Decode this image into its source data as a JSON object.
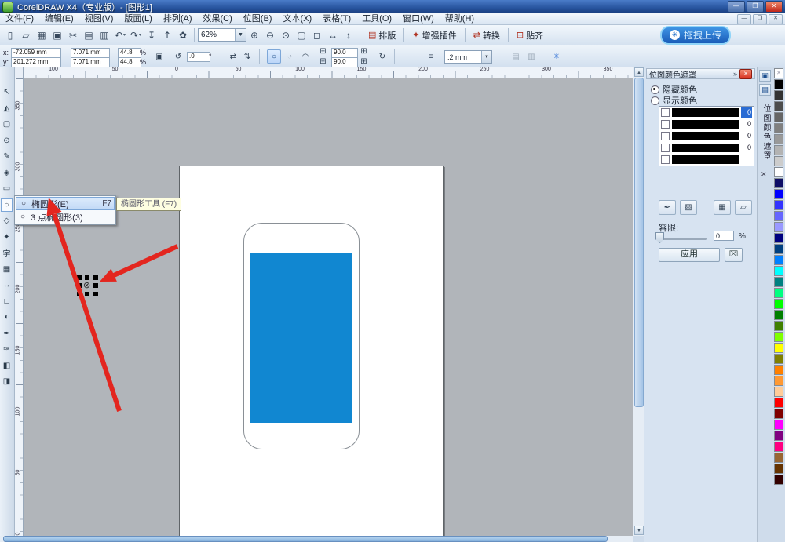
{
  "colors": {
    "accent_blue": "#2a6cd4",
    "annotation_red": "#e3261f",
    "screen_blue": "#1187d1",
    "workspace_gray": "#b1b5ba"
  },
  "window": {
    "title": "CorelDRAW X4（专业版）- [图形1]",
    "controls": {
      "minimize": "—",
      "maximize": "❐",
      "close": "✕"
    }
  },
  "menu_bar": {
    "items": [
      "文件(F)",
      "编辑(E)",
      "视图(V)",
      "版面(L)",
      "排列(A)",
      "效果(C)",
      "位图(B)",
      "文本(X)",
      "表格(T)",
      "工具(O)",
      "窗口(W)",
      "帮助(H)"
    ],
    "doc_controls": [
      "—",
      "❐",
      "✕"
    ]
  },
  "standard_toolbar": {
    "icon_buttons": [
      {
        "name": "new-document-button",
        "glyph": "▯"
      },
      {
        "name": "open-button",
        "glyph": "▱"
      },
      {
        "name": "save-button",
        "glyph": "▦"
      },
      {
        "name": "print-button",
        "glyph": "▣"
      },
      {
        "name": "cut-button",
        "glyph": "✂"
      },
      {
        "name": "copy-button",
        "glyph": "▤"
      },
      {
        "name": "paste-button",
        "glyph": "▥"
      },
      {
        "name": "undo-button",
        "glyph": "↶",
        "dropdown": true
      },
      {
        "name": "redo-button",
        "glyph": "↷",
        "dropdown": true
      },
      {
        "name": "import-button",
        "glyph": "↧"
      },
      {
        "name": "export-button",
        "glyph": "↥"
      },
      {
        "name": "app-launcher-button",
        "glyph": "✿"
      }
    ],
    "zoom_combo": "62%",
    "zoom_tools": [
      {
        "name": "zoom-in-button",
        "glyph": "⊕"
      },
      {
        "name": "zoom-out-button",
        "glyph": "⊖"
      },
      {
        "name": "zoom-selected-button",
        "glyph": "⊙"
      },
      {
        "name": "zoom-all-objects-button",
        "glyph": "▢"
      },
      {
        "name": "zoom-page-button",
        "glyph": "◻"
      },
      {
        "name": "zoom-width-button",
        "glyph": "↔"
      },
      {
        "name": "zoom-height-button",
        "glyph": "↕"
      }
    ],
    "text_buttons": [
      {
        "name": "layout-button",
        "glyph": "▤",
        "label": "排版"
      },
      {
        "name": "plugin-button",
        "glyph": "✦",
        "label": "增强插件"
      },
      {
        "name": "convert-button",
        "glyph": "⇄",
        "label": "转换"
      },
      {
        "name": "snap-button",
        "glyph": "⊞",
        "label": "贴齐"
      }
    ],
    "upload_button": {
      "label": "拖拽上传",
      "badge_glyph": "✳"
    }
  },
  "property_bar": {
    "x_label": "x:",
    "x_value": "-72.059 mm",
    "y_label": "y:",
    "y_value": "201.272 mm",
    "width_value": "7.071 mm",
    "height_value": "7.071 mm",
    "scale_x": "44.8",
    "scale_y": "44.8",
    "scale_unit": "%",
    "lock_glyph": "▣",
    "rotation_glyph": "↺",
    "rotation_value": ".0",
    "rotation_unit": "°",
    "mirror_h_glyph": "⇄",
    "mirror_v_glyph": "⇅",
    "ellipse_glyph": "○",
    "pie_glyph": "◔",
    "arc_glyph": "◠",
    "grid_glyph": "⊞",
    "arc_start": "90.0",
    "arc_end": "90.0",
    "direction_glyph": "↻",
    "wrap_glyph": "≡",
    "outline_width": ".2 mm",
    "extra1_glyph": "▤",
    "extra2_glyph": "▥",
    "gear_glyph": "✳"
  },
  "rulers": {
    "unit": "mm",
    "top_labels": [
      "100",
      "50",
      "0",
      "50",
      "100",
      "150",
      "200",
      "250",
      "300",
      "350"
    ],
    "left_labels": [
      "350",
      "300",
      "250",
      "200",
      "150",
      "100",
      "50",
      "0"
    ]
  },
  "toolbox": {
    "tools": [
      {
        "name": "pick-tool",
        "glyph": "↖"
      },
      {
        "name": "shape-tool",
        "glyph": "◭"
      },
      {
        "name": "crop-tool",
        "glyph": "▢"
      },
      {
        "name": "zoom-tool",
        "glyph": "⊙"
      },
      {
        "name": "freehand-tool",
        "glyph": "✎"
      },
      {
        "name": "smart-fill-tool",
        "glyph": "◈"
      },
      {
        "name": "rectangle-tool",
        "glyph": "▭"
      },
      {
        "name": "ellipse-tool",
        "glyph": "○",
        "active": true
      },
      {
        "name": "polygon-tool",
        "glyph": "◇"
      },
      {
        "name": "basic-shapes-tool",
        "glyph": "✦"
      },
      {
        "name": "text-tool",
        "glyph": "字"
      },
      {
        "name": "table-tool",
        "glyph": "▦"
      },
      {
        "name": "dimension-tool",
        "glyph": "↔"
      },
      {
        "name": "connector-tool",
        "glyph": "∟"
      },
      {
        "name": "blend-tool",
        "glyph": "◐"
      },
      {
        "name": "eyedropper-tool",
        "glyph": "✒"
      },
      {
        "name": "outline-pen-tool",
        "glyph": "✑"
      },
      {
        "name": "fill-tool",
        "glyph": "◧"
      },
      {
        "name": "interactive-fill-tool",
        "glyph": "◨"
      }
    ]
  },
  "flyout": {
    "items": [
      {
        "icon": "○",
        "label": "椭圆形(E)",
        "shortcut": "F7",
        "selected": true
      },
      {
        "icon": "○",
        "label": "3 点椭圆形(3)",
        "shortcut": "",
        "selected": false
      }
    ],
    "tooltip": "椭圆形工具 (F7)"
  },
  "docker": {
    "title": "位图颜色遮罩",
    "collapse_glyph": "»",
    "close_glyph": "✕",
    "radio_hide": "隐藏颜色",
    "radio_show": "显示颜色",
    "radio_selected": "hide",
    "mask_rows": [
      {
        "checked": false,
        "value": "0",
        "selected": true
      },
      {
        "checked": false,
        "value": "0",
        "selected": false
      },
      {
        "checked": false,
        "value": "0",
        "selected": false
      },
      {
        "checked": false,
        "value": "0",
        "selected": false
      },
      {
        "checked": false,
        "value": "",
        "selected": false
      }
    ],
    "buttons": [
      {
        "name": "eyedropper-button",
        "glyph": "✒"
      },
      {
        "name": "add-color-button",
        "glyph": "▨"
      },
      {
        "name": "save-mask-button",
        "glyph": "▦"
      },
      {
        "name": "open-mask-button",
        "glyph": "▱"
      }
    ],
    "tolerance_label": "容限:",
    "tolerance_value": "0",
    "tolerance_unit": "%",
    "apply_label": "应用",
    "delete_glyph": "⌧",
    "tab_title": "位图颜色遮罩",
    "tab_icons": [
      {
        "name": "docker-tab-hint-icon",
        "glyph": "▣"
      },
      {
        "name": "docker-tab-mask-icon",
        "glyph": "▤"
      }
    ],
    "tab_close_glyph": "✕"
  },
  "palette": {
    "colors": [
      "none",
      "#000000",
      "#333333",
      "#4d4d4d",
      "#666666",
      "#808080",
      "#999999",
      "#b3b3b3",
      "#cccccc",
      "#ffffff",
      "#0d0d66",
      "#0000ff",
      "#3333ff",
      "#6666ff",
      "#9999ff",
      "#000080",
      "#004080",
      "#0080ff",
      "#00ffff",
      "#008080",
      "#00ff80",
      "#00ff00",
      "#008000",
      "#408000",
      "#80ff00",
      "#ffff00",
      "#808000",
      "#ff8000",
      "#ff9933",
      "#ffcc99",
      "#ff0000",
      "#800000",
      "#ff00ff",
      "#800080",
      "#ff0080",
      "#996633",
      "#663300",
      "#330000"
    ]
  },
  "canvas": {
    "page_color": "#ffffff",
    "screen_color": "#1187d1"
  }
}
